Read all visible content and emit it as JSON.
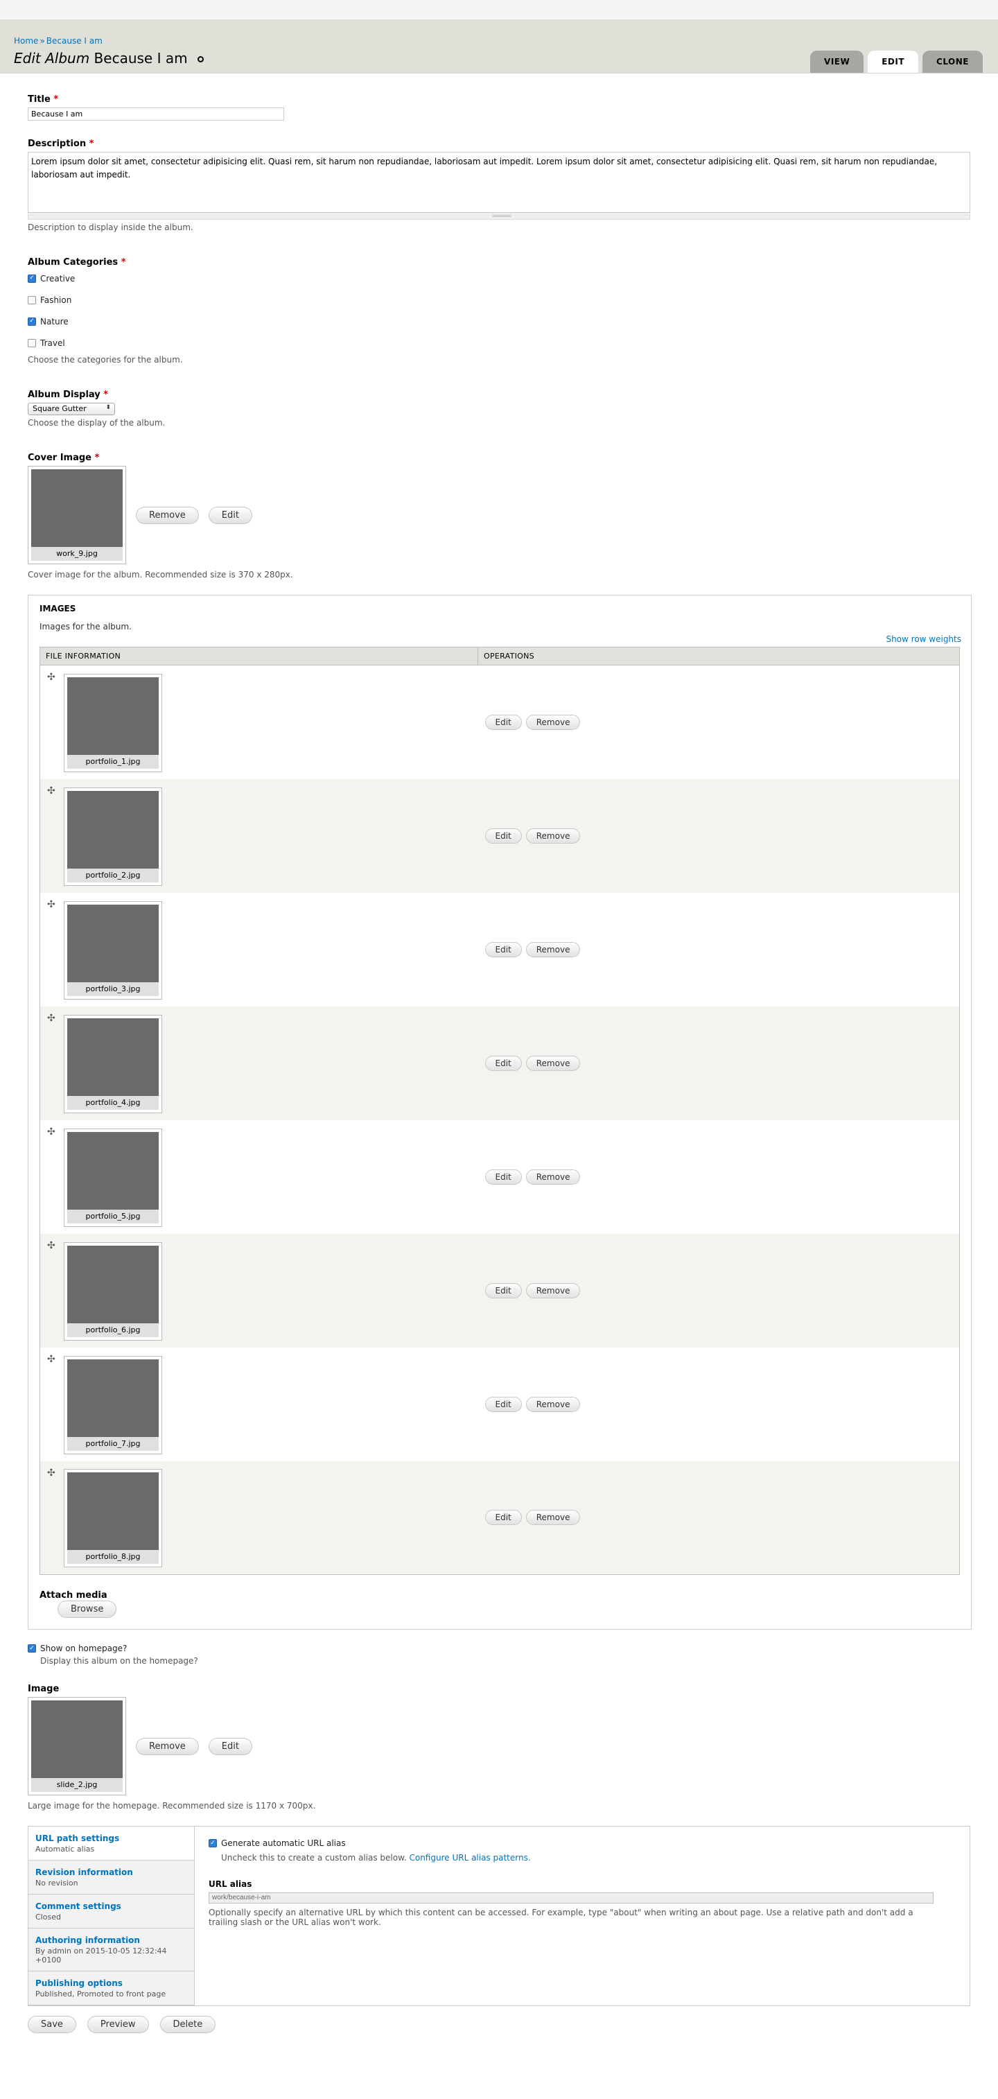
{
  "breadcrumb": {
    "home": "Home",
    "sep": "»",
    "current": "Because I am"
  },
  "page": {
    "title_prefix": "Edit Album",
    "title_name": "Because I am"
  },
  "tabs": {
    "view": "VIEW",
    "edit": "EDIT",
    "clone": "CLONE"
  },
  "title_field": {
    "label": "Title",
    "required": "*",
    "value": "Because I am"
  },
  "description_field": {
    "label": "Description",
    "required": "*",
    "value": "Lorem ipsum dolor sit amet, consectetur adipisicing elit. Quasi rem, sit harum non repudiandae, laboriosam aut impedit. Lorem ipsum dolor sit amet, consectetur adipisicing elit. Quasi rem, sit harum non repudiandae, laboriosam aut impedit.",
    "help": "Description to display inside the album."
  },
  "categories": {
    "label": "Album Categories",
    "required": "*",
    "items": [
      {
        "label": "Creative",
        "checked": true
      },
      {
        "label": "Fashion",
        "checked": false
      },
      {
        "label": "Nature",
        "checked": true
      },
      {
        "label": "Travel",
        "checked": false
      }
    ],
    "help": "Choose the categories for the album."
  },
  "display": {
    "label": "Album Display",
    "required": "*",
    "value": "Square Gutter",
    "help": "Choose the display of the album."
  },
  "cover": {
    "label": "Cover Image",
    "required": "*",
    "file": "work_9.jpg",
    "remove": "Remove",
    "edit": "Edit",
    "help": "Cover image for the album. Recommended size is 370 x 280px."
  },
  "images": {
    "legend": "IMAGES",
    "help": "Images for the album.",
    "row_weights": "Show row weights",
    "col_file": "FILE INFORMATION",
    "col_ops": "OPERATIONS",
    "edit": "Edit",
    "remove": "Remove",
    "rows": [
      {
        "file": "portfolio_1.jpg"
      },
      {
        "file": "portfolio_2.jpg"
      },
      {
        "file": "portfolio_3.jpg"
      },
      {
        "file": "portfolio_4.jpg"
      },
      {
        "file": "portfolio_5.jpg"
      },
      {
        "file": "portfolio_6.jpg"
      },
      {
        "file": "portfolio_7.jpg"
      },
      {
        "file": "portfolio_8.jpg"
      }
    ],
    "attach_label": "Attach media",
    "browse": "Browse"
  },
  "homepage": {
    "label": "Show on homepage?",
    "checked": true,
    "help": "Display this album on the homepage?"
  },
  "home_image": {
    "label": "Image",
    "file": "slide_2.jpg",
    "remove": "Remove",
    "edit": "Edit",
    "help": "Large image for the homepage. Recommended size is 1170 x 700px."
  },
  "vertical_tabs": [
    {
      "title": "URL path settings",
      "summary": "Automatic alias"
    },
    {
      "title": "Revision information",
      "summary": "No revision"
    },
    {
      "title": "Comment settings",
      "summary": "Closed"
    },
    {
      "title": "Authoring information",
      "summary": "By admin on 2015-10-05 12:32:44 +0100"
    },
    {
      "title": "Publishing options",
      "summary": "Published, Promoted to front page"
    }
  ],
  "url_pane": {
    "auto_label": "Generate automatic URL alias",
    "auto_checked": true,
    "uncheck_help": "Uncheck this to create a custom alias below.",
    "configure_link": "Configure URL alias patterns.",
    "alias_label": "URL alias",
    "alias_value": "work/because-i-am",
    "alias_help": "Optionally specify an alternative URL by which this content can be accessed. For example, type \"about\" when writing an about page. Use a relative path and don't add a trailing slash or the URL alias won't work."
  },
  "actions": {
    "save": "Save",
    "preview": "Preview",
    "delete": "Delete"
  }
}
